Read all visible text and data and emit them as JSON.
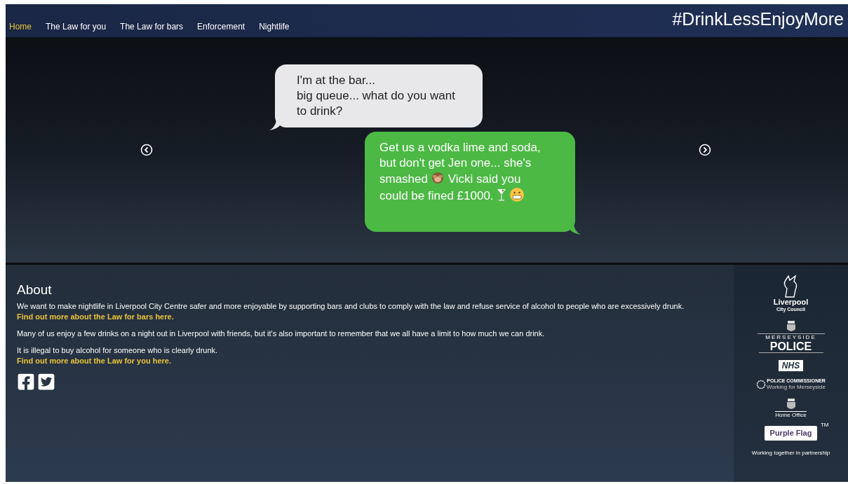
{
  "nav": {
    "items": [
      {
        "label": "Home",
        "selected": true
      },
      {
        "label": "The Law for you",
        "selected": false
      },
      {
        "label": "The Law for bars",
        "selected": false
      },
      {
        "label": "Enforcement",
        "selected": false
      },
      {
        "label": "Nightlife",
        "selected": false
      }
    ],
    "hashtag": "#DrinkLessEnjoyMore"
  },
  "carousel": {
    "messages": [
      {
        "kind": "received",
        "lines": [
          "I'm at the bar...",
          "big queue... what do you want to drink?"
        ]
      },
      {
        "kind": "sent",
        "lines": [
          "Get us a vodka lime and soda, but don't get Jen one... she's smashed",
          "Vicki said you could be fined £1000."
        ]
      }
    ]
  },
  "about": {
    "title": "About",
    "blocks": [
      {
        "text": "We want to make nightlife in Liverpool City Centre safer and more enjoyable by supporting bars and clubs to comply with the law and refuse service of alcohol to people who are excessively drunk.",
        "link": "Find out more about the Law for bars here."
      },
      {
        "text": "Many of us enjoy a few drinks on a night out in Liverpool with friends, but it's also important to remember that we all have a limit to how much we can drink."
      },
      {
        "text": "It is illegal to buy alcohol for someone who is clearly drunk.",
        "link": "Find out more about the Law for you here."
      }
    ]
  },
  "partners": {
    "logos": [
      {
        "kind": "council",
        "lines": [
          "Liverpool",
          "City Council"
        ]
      },
      {
        "kind": "police",
        "lines": [
          "MERSEYSIDE",
          "POLICE"
        ]
      },
      {
        "kind": "nhs",
        "lines": [
          "NHS"
        ]
      },
      {
        "kind": "commissioner",
        "lines": [
          "POLICE COMMISSIONER",
          "Working for Merseyside"
        ]
      },
      {
        "kind": "homeoffice",
        "lines": [
          "Home Office"
        ]
      },
      {
        "kind": "flag",
        "lines": [
          "Purple Flag",
          "TM"
        ]
      }
    ],
    "tagline": "Working together in partnership"
  }
}
